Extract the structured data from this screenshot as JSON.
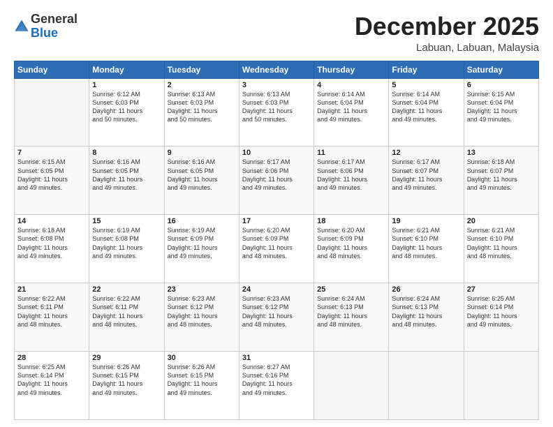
{
  "logo": {
    "general": "General",
    "blue": "Blue"
  },
  "title": "December 2025",
  "location": "Labuan, Labuan, Malaysia",
  "days_header": [
    "Sunday",
    "Monday",
    "Tuesday",
    "Wednesday",
    "Thursday",
    "Friday",
    "Saturday"
  ],
  "weeks": [
    [
      {
        "day": "",
        "info": ""
      },
      {
        "day": "1",
        "info": "Sunrise: 6:12 AM\nSunset: 6:03 PM\nDaylight: 11 hours\nand 50 minutes."
      },
      {
        "day": "2",
        "info": "Sunrise: 6:13 AM\nSunset: 6:03 PM\nDaylight: 11 hours\nand 50 minutes."
      },
      {
        "day": "3",
        "info": "Sunrise: 6:13 AM\nSunset: 6:03 PM\nDaylight: 11 hours\nand 50 minutes."
      },
      {
        "day": "4",
        "info": "Sunrise: 6:14 AM\nSunset: 6:04 PM\nDaylight: 11 hours\nand 49 minutes."
      },
      {
        "day": "5",
        "info": "Sunrise: 6:14 AM\nSunset: 6:04 PM\nDaylight: 11 hours\nand 49 minutes."
      },
      {
        "day": "6",
        "info": "Sunrise: 6:15 AM\nSunset: 6:04 PM\nDaylight: 11 hours\nand 49 minutes."
      }
    ],
    [
      {
        "day": "7",
        "info": "Sunrise: 6:15 AM\nSunset: 6:05 PM\nDaylight: 11 hours\nand 49 minutes."
      },
      {
        "day": "8",
        "info": "Sunrise: 6:16 AM\nSunset: 6:05 PM\nDaylight: 11 hours\nand 49 minutes."
      },
      {
        "day": "9",
        "info": "Sunrise: 6:16 AM\nSunset: 6:05 PM\nDaylight: 11 hours\nand 49 minutes."
      },
      {
        "day": "10",
        "info": "Sunrise: 6:17 AM\nSunset: 6:06 PM\nDaylight: 11 hours\nand 49 minutes."
      },
      {
        "day": "11",
        "info": "Sunrise: 6:17 AM\nSunset: 6:06 PM\nDaylight: 11 hours\nand 49 minutes."
      },
      {
        "day": "12",
        "info": "Sunrise: 6:17 AM\nSunset: 6:07 PM\nDaylight: 11 hours\nand 49 minutes."
      },
      {
        "day": "13",
        "info": "Sunrise: 6:18 AM\nSunset: 6:07 PM\nDaylight: 11 hours\nand 49 minutes."
      }
    ],
    [
      {
        "day": "14",
        "info": "Sunrise: 6:18 AM\nSunset: 6:08 PM\nDaylight: 11 hours\nand 49 minutes."
      },
      {
        "day": "15",
        "info": "Sunrise: 6:19 AM\nSunset: 6:08 PM\nDaylight: 11 hours\nand 49 minutes."
      },
      {
        "day": "16",
        "info": "Sunrise: 6:19 AM\nSunset: 6:09 PM\nDaylight: 11 hours\nand 49 minutes."
      },
      {
        "day": "17",
        "info": "Sunrise: 6:20 AM\nSunset: 6:09 PM\nDaylight: 11 hours\nand 48 minutes."
      },
      {
        "day": "18",
        "info": "Sunrise: 6:20 AM\nSunset: 6:09 PM\nDaylight: 11 hours\nand 48 minutes."
      },
      {
        "day": "19",
        "info": "Sunrise: 6:21 AM\nSunset: 6:10 PM\nDaylight: 11 hours\nand 48 minutes."
      },
      {
        "day": "20",
        "info": "Sunrise: 6:21 AM\nSunset: 6:10 PM\nDaylight: 11 hours\nand 48 minutes."
      }
    ],
    [
      {
        "day": "21",
        "info": "Sunrise: 6:22 AM\nSunset: 6:11 PM\nDaylight: 11 hours\nand 48 minutes."
      },
      {
        "day": "22",
        "info": "Sunrise: 6:22 AM\nSunset: 6:11 PM\nDaylight: 11 hours\nand 48 minutes."
      },
      {
        "day": "23",
        "info": "Sunrise: 6:23 AM\nSunset: 6:12 PM\nDaylight: 11 hours\nand 48 minutes."
      },
      {
        "day": "24",
        "info": "Sunrise: 6:23 AM\nSunset: 6:12 PM\nDaylight: 11 hours\nand 48 minutes."
      },
      {
        "day": "25",
        "info": "Sunrise: 6:24 AM\nSunset: 6:13 PM\nDaylight: 11 hours\nand 48 minutes."
      },
      {
        "day": "26",
        "info": "Sunrise: 6:24 AM\nSunset: 6:13 PM\nDaylight: 11 hours\nand 48 minutes."
      },
      {
        "day": "27",
        "info": "Sunrise: 6:25 AM\nSunset: 6:14 PM\nDaylight: 11 hours\nand 49 minutes."
      }
    ],
    [
      {
        "day": "28",
        "info": "Sunrise: 6:25 AM\nSunset: 6:14 PM\nDaylight: 11 hours\nand 49 minutes."
      },
      {
        "day": "29",
        "info": "Sunrise: 6:26 AM\nSunset: 6:15 PM\nDaylight: 11 hours\nand 49 minutes."
      },
      {
        "day": "30",
        "info": "Sunrise: 6:26 AM\nSunset: 6:15 PM\nDaylight: 11 hours\nand 49 minutes."
      },
      {
        "day": "31",
        "info": "Sunrise: 6:27 AM\nSunset: 6:16 PM\nDaylight: 11 hours\nand 49 minutes."
      },
      {
        "day": "",
        "info": ""
      },
      {
        "day": "",
        "info": ""
      },
      {
        "day": "",
        "info": ""
      }
    ]
  ]
}
